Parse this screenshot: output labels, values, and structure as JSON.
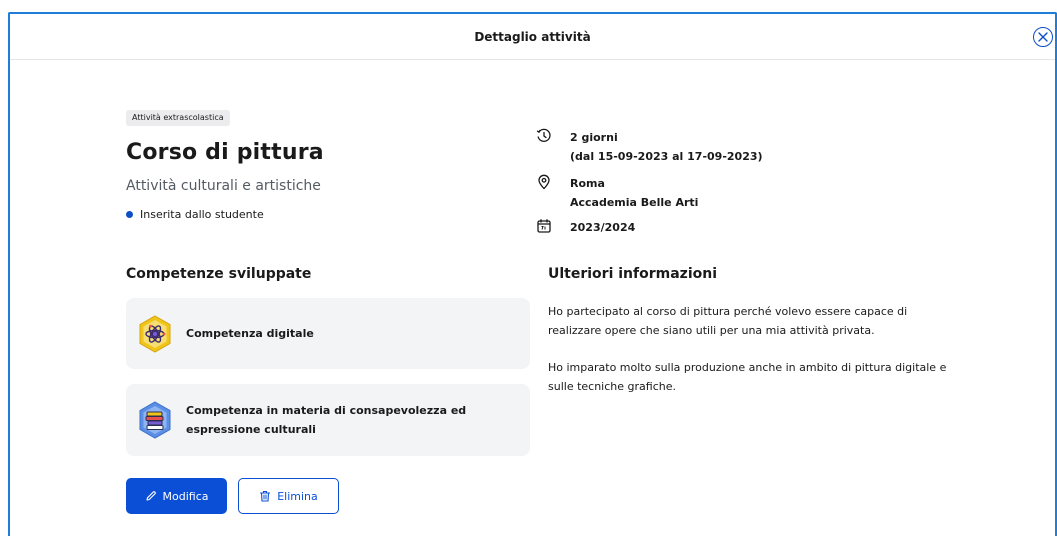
{
  "header": {
    "title": "Dettaglio attività",
    "close_icon": "close-icon"
  },
  "activity": {
    "tag": "Attività extrascolastica",
    "title": "Corso di pittura",
    "category": "Attività culturali e artistiche",
    "inserted_by": "Inserita dallo studente",
    "duration": "2 giorni",
    "dates": "(dal 15-09-2023 al 17-09-2023)",
    "city": "Roma",
    "place": "Accademia Belle Arti",
    "school_year": "2023/2024"
  },
  "competences": {
    "title": "Competenze sviluppate",
    "items": [
      {
        "label": "Competenza digitale",
        "icon": "atom-badge-icon"
      },
      {
        "label": "Competenza in materia di consapevolezza ed espressione culturali",
        "icon": "books-badge-icon"
      }
    ]
  },
  "info": {
    "title": "Ulteriori informazioni",
    "paragraphs": [
      "Ho partecipato al corso di pittura perché volevo essere capace di realizzare opere che siano utili per una mia attività privata.",
      "Ho imparato molto sulla produzione anche in ambito di pittura digitale e sulle tecniche grafiche."
    ]
  },
  "actions": {
    "edit_label": "Modifica",
    "delete_label": "Elimina"
  },
  "colors": {
    "accent": "#0b4fd7",
    "border": "#1f7fd6",
    "card": "#f3f4f6"
  }
}
